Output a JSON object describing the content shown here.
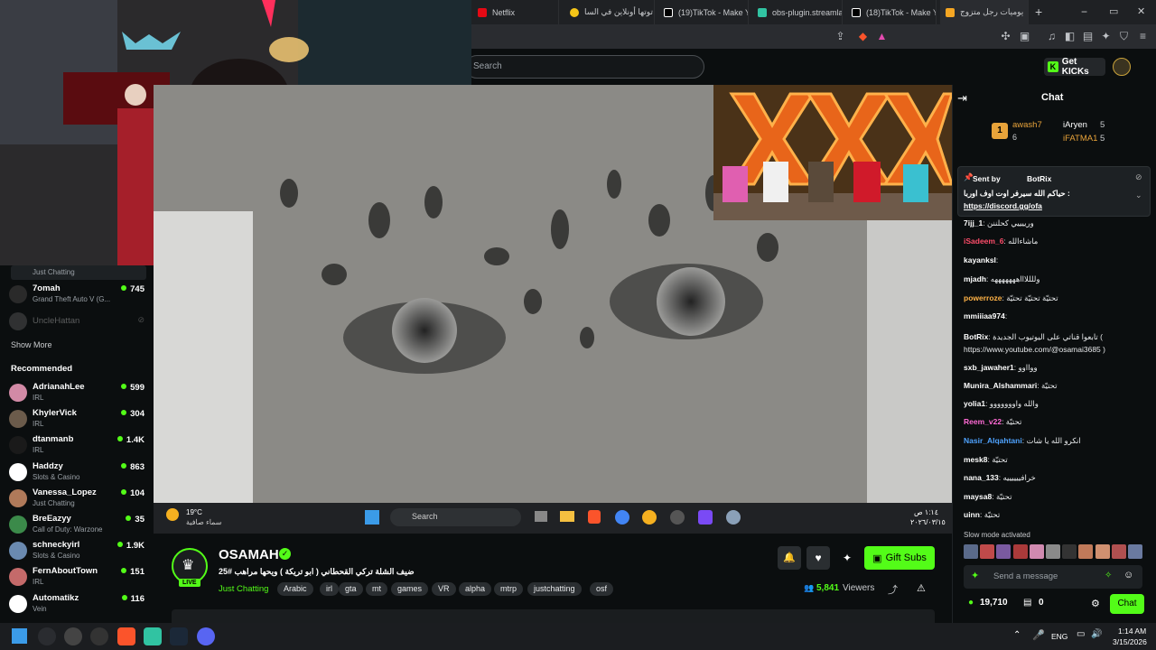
{
  "browser": {
    "tabs": [
      {
        "label": "Netflix",
        "color": "#e50914"
      },
      {
        "label": "توتها أونلاين في السا",
        "color": "#f5c518"
      },
      {
        "label": "(19)TikTok - Make Y",
        "color": "#ffffff"
      },
      {
        "label": "obs-plugin.streamla",
        "color": "#31c3a2"
      },
      {
        "label": "(18)TikTok - Make Y",
        "color": "#ffffff"
      },
      {
        "label": "يوميات رجل متزوج",
        "color": "#f5a623"
      }
    ],
    "new_tab": "+",
    "win_min": "−",
    "win_max": "▭",
    "win_close": "✕"
  },
  "header": {
    "search_placeholder": "Search",
    "get_kicks": "Get KICKs"
  },
  "sidebar": {
    "top_category": "Just Chatting",
    "following": [
      {
        "name": "7omah",
        "category": "Grand Theft Auto V (G...",
        "viewers": "745",
        "color": "#2a2a2a"
      },
      {
        "name": "UncleHattan",
        "category": "",
        "viewers": "",
        "color": "#555",
        "offline": true
      }
    ],
    "show_more": "Show More",
    "recommended_title": "Recommended",
    "recommended": [
      {
        "name": "AdrianahLee",
        "category": "IRL",
        "viewers": "599",
        "color": "#d28aa6"
      },
      {
        "name": "KhylerVick",
        "category": "IRL",
        "viewers": "304",
        "color": "#6b5b4b"
      },
      {
        "name": "dtanmanb",
        "category": "IRL",
        "viewers": "1.4K",
        "color": "#1a1a1a"
      },
      {
        "name": "Haddzy",
        "category": "Slots & Casino",
        "viewers": "863",
        "color": "#ffffff"
      },
      {
        "name": "Vanessa_Lopez",
        "category": "Just Chatting",
        "viewers": "104",
        "color": "#b07a5a"
      },
      {
        "name": "BreEazyy",
        "category": "Call of Duty: Warzone",
        "viewers": "35",
        "color": "#3b8a4a"
      },
      {
        "name": "schneckyirl",
        "category": "Slots & Casino",
        "viewers": "1.9K",
        "color": "#6a8ab0"
      },
      {
        "name": "FernAboutTown",
        "category": "IRL",
        "viewers": "151",
        "color": "#c46a6a"
      },
      {
        "name": "Automatikz",
        "category": "Vein",
        "viewers": "116",
        "color": "#ffffff"
      }
    ]
  },
  "stream_taskbar": {
    "weather_temp": "19°C",
    "weather_text": "سماء صافية",
    "search": "Search",
    "time": "١:١٤ ص",
    "date": "٢٠٢٦/٠٣/١٥"
  },
  "stream": {
    "name": "OSAMAH",
    "live_badge": "LIVE",
    "title": "ضيف الشلة تركي القحطاني ( ابو تريكة ) ويحها مراهب #25",
    "category": "Just Chatting",
    "tags": [
      "Arabic",
      "irl",
      "gta",
      "mt",
      "games",
      "VR",
      "alpha",
      "mtrp",
      "justchatting",
      "osf"
    ],
    "gift_subs": "Gift Subs",
    "viewers": "5,841",
    "viewers_label": "Viewers"
  },
  "chat": {
    "title": "Chat",
    "leaderboard": [
      {
        "rank": "1",
        "name": "awash7",
        "count": "6",
        "color": "#e8a33a"
      },
      {
        "name": "iAryen",
        "count": "5",
        "color": "#ffffff"
      },
      {
        "name": "iFATMA1",
        "count": "5",
        "color": "#e8a33a"
      }
    ],
    "pinned": {
      "sent_by": "Sent by",
      "user": "BotRix",
      "text": "حياكم الله سيرفر اوت اوف اوربا :",
      "link": "https://discord.gg/ofa"
    },
    "messages": [
      {
        "user": "7ijj_1",
        "text": "ورييييي كحلننن",
        "color": "#ffffff"
      },
      {
        "user": "iSadeem_6",
        "text": "ماشاءالله",
        "color": "#ff4d6a"
      },
      {
        "user": "kayanksl",
        "text": "",
        "color": "#ffffff"
      },
      {
        "user": "mjadh",
        "text": "وللللاااهههههههه",
        "color": "#ffffff"
      },
      {
        "user": "powerroze",
        "text": "تحتيّة تحتيّة تحتيّة",
        "color": "#ffb347"
      },
      {
        "user": "mmiiiaa974",
        "text": "",
        "color": "#ffffff"
      },
      {
        "user": "BotRix",
        "text": "تابعوا قناتي على اليوتيوب الجديدة ( https://www.youtube.com/@osamai3685 )",
        "color": "#ffffff"
      },
      {
        "user": "sxb_jawaher1",
        "text": "ووااوو",
        "color": "#ffffff"
      },
      {
        "user": "Munira_Alshammari",
        "text": "تحتيّة",
        "color": "#ffffff"
      },
      {
        "user": "yolia1",
        "text": "والله واووووووو",
        "color": "#ffffff"
      },
      {
        "user": "Reem_v22",
        "text": "تحتيّة",
        "color": "#ff6ad5"
      },
      {
        "user": "Nasir_Alqahtani",
        "text": "انكرو الله يا شات",
        "color": "#4fa3ff"
      },
      {
        "user": "mesk8",
        "text": "تحتيّة",
        "color": "#ffffff"
      },
      {
        "user": "nana_133",
        "text": "خرافييييييه",
        "color": "#ffffff"
      },
      {
        "user": "maysa8",
        "text": "تحتيّة",
        "color": "#ffffff"
      },
      {
        "user": "uinn",
        "text": "تحتيّة",
        "color": "#ffffff"
      }
    ],
    "slow_mode": "Slow mode activated",
    "input_placeholder": "Send a message",
    "kicks_count": "19,710",
    "sub_count": "0",
    "chat_button": "Chat"
  },
  "windows": {
    "lang": "ENG",
    "time": "1:14 AM",
    "date": "3/15/2026"
  },
  "colors": {
    "accent": "#53fc18",
    "bg": "#0b0e0f"
  }
}
